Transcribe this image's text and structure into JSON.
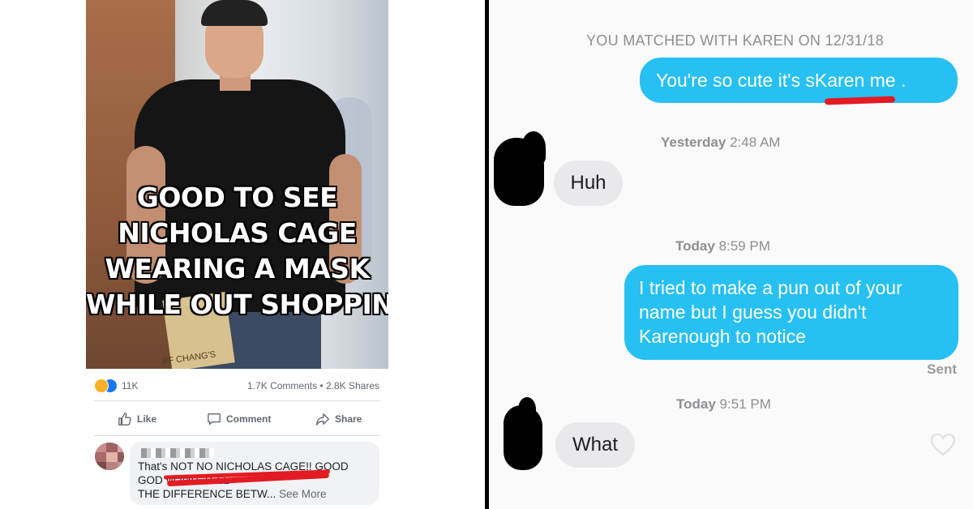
{
  "left_post": {
    "meme_lines": [
      "GOOD TO SEE",
      "NICHOLAS CAGE",
      "WEARING A MASK",
      "WHILE OUT SHOPPING"
    ],
    "bag_label": "PF CHANG'S",
    "reaction_count": "11K",
    "engagement": "1.7K Comments • 2.8K Shares",
    "actions": {
      "like": "Like",
      "comment": "Comment",
      "share": "Share"
    },
    "comment": {
      "line_1": "That's NOT NO NICHOLAS CAGE!!  GOOD",
      "line_2": "GOD W                              ANT TELL",
      "line_3": "THE DIFFERENCE BETW...",
      "see_more": "See More"
    }
  },
  "right_chat": {
    "match_header": "YOU MATCHED WITH KAREN ON 12/31/18",
    "messages": [
      {
        "text": "You're so cute it's sKaren me ."
      },
      {
        "time_day": "Yesterday",
        "time_clock": "2:48 AM"
      },
      {
        "text": "Huh"
      },
      {
        "time_day": "Today",
        "time_clock": "8:59 PM"
      },
      {
        "text": "I tried to make a pun out of your name but I guess you didn't Karenough to notice"
      },
      {
        "text": "Sent"
      },
      {
        "time_day": "Today",
        "time_clock": "9:51 PM"
      },
      {
        "text": "What"
      }
    ]
  },
  "colors": {
    "tinder_bubble": "#27c0f2",
    "received_bubble": "#e9e9eb",
    "redaction": "#e31b23",
    "facebook_blue": "#1877f2"
  }
}
